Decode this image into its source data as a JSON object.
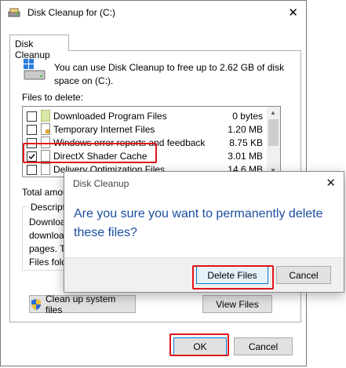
{
  "window": {
    "title": "Disk Cleanup for  (C:)",
    "close_glyph": "✕",
    "tab_label": "Disk Cleanup",
    "intro_text": "You can use Disk Cleanup to free up to 2.62 GB of disk space on  (C:).",
    "files_label": "Files to delete:",
    "files": [
      {
        "name": "Downloaded Program Files",
        "size": "0 bytes",
        "checked": false,
        "icon": "folder-icon"
      },
      {
        "name": "Temporary Internet Files",
        "size": "1.20 MB",
        "checked": false,
        "icon": "lock-file-icon"
      },
      {
        "name": "Windows error reports and feedback di...",
        "size": "8.75 KB",
        "checked": false,
        "icon": "file-icon"
      },
      {
        "name": "DirectX Shader Cache",
        "size": "3.01 MB",
        "checked": true,
        "icon": "file-icon"
      },
      {
        "name": "Delivery Optimization Files",
        "size": "14.6 MB",
        "checked": false,
        "icon": "file-icon"
      }
    ],
    "total_label": "Total amou",
    "description_legend": "Descriptio",
    "description_text": "Download\ndownloade\npages. Th\nFiles folde",
    "cleanup_system_label": "Clean up system files",
    "view_files_label": "View Files",
    "ok_label": "OK",
    "cancel_label": "Cancel"
  },
  "dialog": {
    "title": "Disk Cleanup",
    "close_glyph": "✕",
    "message": "Are you sure you want to permanently delete these files?",
    "delete_label": "Delete Files",
    "cancel_label": "Cancel"
  },
  "colors": {
    "highlight": "#e0141b",
    "dialog_message": "#1b4ea0",
    "default_button_border": "#0078d7"
  }
}
